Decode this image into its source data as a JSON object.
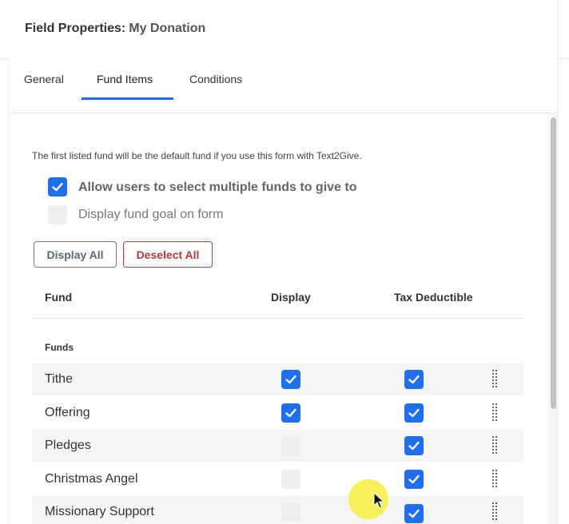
{
  "header": {
    "title": "Field Properties:",
    "subtitle": "My Donation"
  },
  "tabs": [
    {
      "label": "General"
    },
    {
      "label": "Fund Items"
    },
    {
      "label": "Conditions"
    }
  ],
  "active_tab": "Fund Items",
  "note": "The first listed fund will be the default fund if you use this form with Text2Give.",
  "options": [
    {
      "label": "Allow users to select multiple funds to give to",
      "checked": true
    },
    {
      "label": "Display fund goal on form",
      "checked": false
    }
  ],
  "buttons": {
    "display_all": "Display All",
    "deselect_all": "Deselect All"
  },
  "table": {
    "headers": {
      "fund": "Fund",
      "display": "Display",
      "tax": "Tax Deductible"
    },
    "group": "Funds",
    "rows": [
      {
        "name": "Tithe",
        "display": true,
        "tax": true
      },
      {
        "name": "Offering",
        "display": true,
        "tax": true
      },
      {
        "name": "Pledges",
        "display": false,
        "tax": true
      },
      {
        "name": "Christmas Angel",
        "display": false,
        "tax": true
      },
      {
        "name": "Missionary Support",
        "display": false,
        "tax": true
      }
    ]
  },
  "colors": {
    "accent": "#1f6feb",
    "danger": "#b23a3a",
    "unchecked": "#eeeeee",
    "row_shade": "#f5f5f5"
  },
  "icons": {
    "check": "checkmark-icon",
    "drag": "drag-handle-icon",
    "cursor": "mouse-pointer-icon"
  }
}
